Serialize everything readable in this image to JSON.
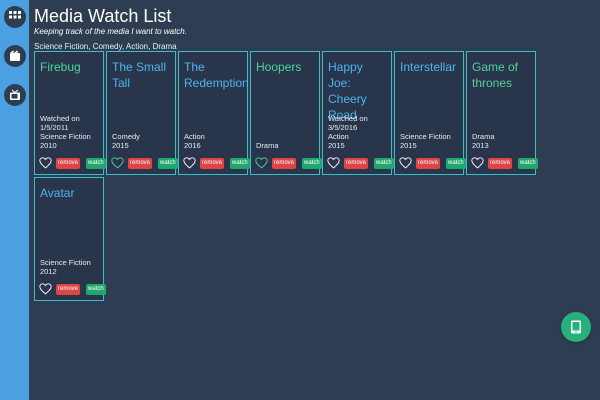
{
  "app": {
    "title": "Media Watch List",
    "subtitle": "Keeping track of the media I want to watch.",
    "genres": "Science Fiction, Comedy, Action, Drama"
  },
  "sidebar": {
    "items": [
      {
        "icon": "grid-icon"
      },
      {
        "icon": "film-icon"
      },
      {
        "icon": "tv-icon"
      }
    ]
  },
  "cards": [
    {
      "title": "Firebug",
      "title_color": "green",
      "heart": "white",
      "info": [
        "Watched on",
        "1/5/2011",
        "Science Fiction",
        "2010"
      ]
    },
    {
      "title": "The Small Tall",
      "title_color": "blue",
      "heart": "green",
      "info": [
        "Comedy",
        "2015"
      ]
    },
    {
      "title": "The Redemption",
      "title_color": "blue",
      "heart": "white",
      "info": [
        "Action",
        "2016"
      ]
    },
    {
      "title": "Hoopers",
      "title_color": "green",
      "heart": "green",
      "info": [
        "Drama"
      ]
    },
    {
      "title": "Happy Joe: Cheery Road",
      "title_color": "blue",
      "heart": "white",
      "info": [
        "Watched on",
        "3/5/2016",
        "Action",
        "2015"
      ]
    },
    {
      "title": "Interstellar",
      "title_color": "blue",
      "heart": "white",
      "info": [
        "Science Fiction",
        "2015"
      ]
    },
    {
      "title": "Game of thrones",
      "title_color": "green",
      "heart": "white",
      "info": [
        "Drama",
        "2013"
      ]
    },
    {
      "title": "Avatar",
      "title_color": "blue",
      "heart": "white",
      "info": [
        "Science Fiction",
        "2012"
      ]
    }
  ],
  "labels": {
    "remove": "remove",
    "watch": "watch"
  },
  "fab": {
    "icon": "phone-icon"
  }
}
